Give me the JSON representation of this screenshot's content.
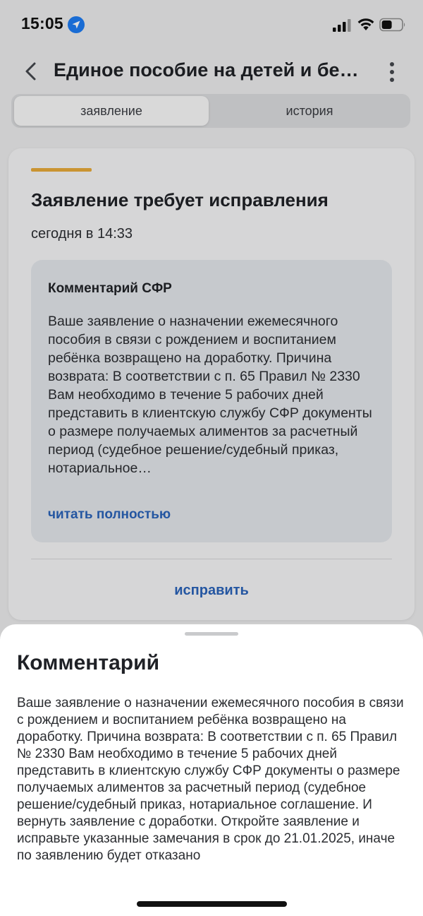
{
  "status_bar": {
    "time": "15:05",
    "icons": [
      "location-arrow-icon",
      "signal-icon",
      "wifi-icon",
      "battery-icon"
    ]
  },
  "header": {
    "back_icon": "chevron-left-icon",
    "title": "Единое пособие на детей и беременных",
    "more_icon": "vertical-dots-icon"
  },
  "tabs": [
    {
      "label": "заявление",
      "active": true
    },
    {
      "label": "история",
      "active": false
    }
  ],
  "card": {
    "status_color": "#e6a93a",
    "title": "Заявление требует исправления",
    "date": "сегодня в 14:33",
    "comment": {
      "heading": "Комментарий СФР",
      "text": "Ваше заявление о назначении ежемесячного пособия в связи с рождением и воспитанием ребёнка возвращено на доработку. Причина возврата: В соответствии с п. 65 Правил № 2330 Вам необходимо в течение 5 рабочих дней представить в клиентскую службу СФР документы о размере получаемых алиментов за расчетный период (судебное решение/судебный приказ, нотариальное…",
      "read_more": "читать полностью"
    },
    "action_label": "исправить"
  },
  "sheet": {
    "title": "Комментарий",
    "text": "Ваше заявление о назначении ежемесячного пособия в связи с рождением и воспитанием ребёнка возвращено на доработку. Причина возврата: В соответствии с п. 65 Правил № 2330 Вам необходимо в течение 5 рабочих дней представить в клиентскую службу СФР документы о размере получаемых алиментов за расчетный период (судебное решение/судебный приказ, нотариальное соглашение. И вернуть заявление с доработки. Откройте заявление и исправьте указанные замечания в срок до 21.01.2025, иначе по заявлению будет отказано"
  },
  "colors": {
    "accent": "#2a62b8",
    "warning": "#e6a93a"
  }
}
